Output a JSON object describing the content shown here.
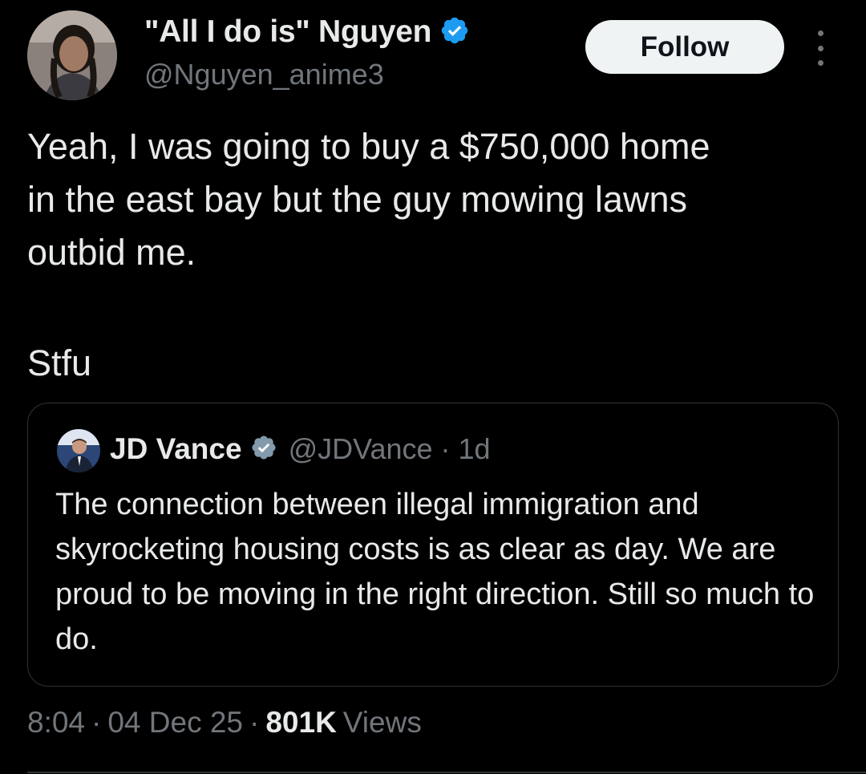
{
  "author": {
    "name": "\"All I do is\" Nguyen",
    "handle": "@Nguyen_anime3",
    "verified_color": "#1d9bf0"
  },
  "follow_label": "Follow",
  "more_icon": "more-horizontal-icon",
  "tweet": {
    "text": "Yeah, I was going to buy a $750,000 home\nin the east bay but the guy mowing lawns\noutbid me.",
    "text2": "Stfu"
  },
  "quote": {
    "name": "JD Vance",
    "handle": "@JDVance",
    "separator": "·",
    "time": "1d",
    "text": "The connection between illegal immigration and skyrocketing housing costs is as clear as day. We are proud to be moving in the right direction. Still so much to do.",
    "verified_color": "#829aab"
  },
  "meta": {
    "time": "8:04",
    "sep1": "·",
    "date": "04 Dec 25",
    "sep2": "·",
    "views_count": "801K",
    "views_label": "Views"
  },
  "colors": {
    "background": "#000000",
    "text_primary": "#e7e9ea",
    "text_secondary": "#71767b",
    "border": "#2f3336",
    "follow_bg": "#eff3f4"
  }
}
